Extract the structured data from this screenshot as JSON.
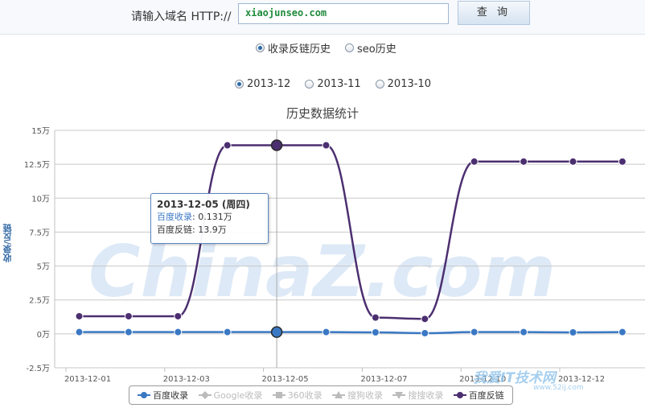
{
  "search": {
    "label": "请输入域名 HTTP://",
    "value": "xiaojunseo.com",
    "button": "查 询"
  },
  "history_tabs": [
    {
      "label": "收录反链历史",
      "checked": true
    },
    {
      "label": "seo历史",
      "checked": false
    }
  ],
  "month_tabs": [
    {
      "label": "2013-12",
      "checked": true
    },
    {
      "label": "2013-11",
      "checked": false
    },
    {
      "label": "2013-10",
      "checked": false
    }
  ],
  "tooltip": {
    "date": "2013-12-05 (周四)",
    "line1_label": "百度收录",
    "line1_value": ": 0.131万",
    "line2": "百度反链: 13.9万"
  },
  "watermark": {
    "big": "ChinaZ.com",
    "site": "我爱IT技术网",
    "url": "www.52ij.com"
  },
  "legend": [
    {
      "name": "百度收录",
      "symbol": "circle",
      "color": "#3a78c4",
      "enabled": true
    },
    {
      "name": "Google收录",
      "symbol": "diamond",
      "color": "#bbbbbb",
      "enabled": false
    },
    {
      "name": "360收录",
      "symbol": "square",
      "color": "#bbbbbb",
      "enabled": false
    },
    {
      "name": "搜狗收录",
      "symbol": "triangle",
      "color": "#bbbbbb",
      "enabled": false
    },
    {
      "name": "搜搜收录",
      "symbol": "triangle-down",
      "color": "#bbbbbb",
      "enabled": false
    },
    {
      "name": "百度反链",
      "symbol": "circle",
      "color": "#4c2f70",
      "enabled": true
    }
  ],
  "chart_data": {
    "type": "line",
    "title": "历史数据统计",
    "ylabel": "收录/反链",
    "y_ticks": [
      "-2.5万",
      "0万",
      "2.5万",
      "5万",
      "7.5万",
      "10万",
      "12.5万",
      "15万"
    ],
    "ylim": [
      -2.5,
      15
    ],
    "y_unit": "万",
    "x": [
      "2013-12-01",
      "2013-12-02",
      "2013-12-03",
      "2013-12-04",
      "2013-12-05",
      "2013-12-06",
      "2013-12-07",
      "2013-12-08",
      "2013-12-09",
      "2013-12-10",
      "2013-12-11",
      "2013-12-12"
    ],
    "x_tick_labels": [
      "2013-12-01",
      "2013-12-03",
      "2013-12-05",
      "2013-12-07",
      "2013-12-10",
      "2013-12-12"
    ],
    "x_tick_index": [
      0,
      2,
      4,
      6,
      8,
      10
    ],
    "highlight_index": 4,
    "grid": true,
    "series": [
      {
        "name": "百度收录",
        "color": "#3a78c4",
        "values": [
          0.131,
          0.131,
          0.131,
          0.131,
          0.131,
          0.131,
          0.11,
          0.05,
          0.131,
          0.131,
          0.11,
          0.131
        ]
      },
      {
        "name": "百度反链",
        "color": "#4c2f70",
        "values": [
          1.3,
          1.3,
          1.3,
          13.9,
          13.9,
          13.9,
          1.2,
          1.1,
          12.7,
          12.7,
          12.7,
          12.7
        ]
      }
    ]
  }
}
